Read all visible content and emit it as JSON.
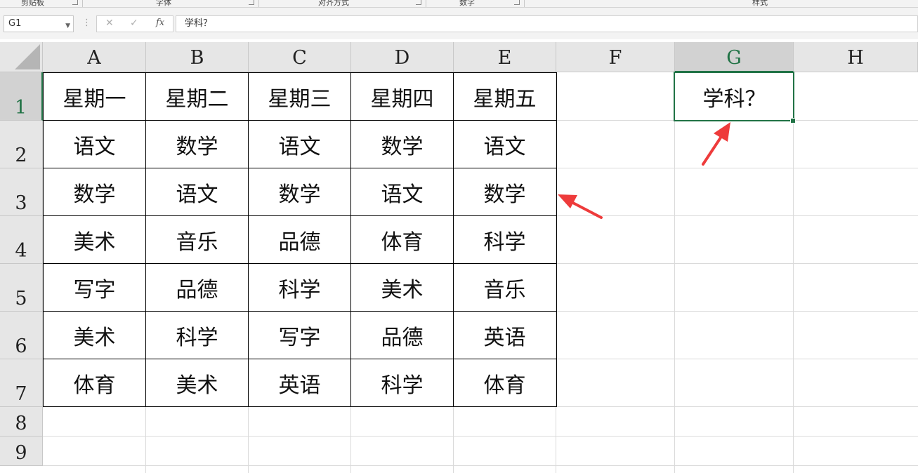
{
  "ribbon": {
    "groups": [
      {
        "label": "剪贴板"
      },
      {
        "label": "字体"
      },
      {
        "label": "对齐方式"
      },
      {
        "label": "数字"
      },
      {
        "label": "样式"
      }
    ]
  },
  "formula_bar": {
    "name_box": "G1",
    "cancel_symbol": "✕",
    "enter_symbol": "✓",
    "fx_label": "fx",
    "content": "学科？"
  },
  "columns": [
    "A",
    "B",
    "C",
    "D",
    "E",
    "F",
    "G",
    "H"
  ],
  "rows": [
    "1",
    "2",
    "3",
    "4",
    "5",
    "6",
    "7",
    "8",
    "9"
  ],
  "table": [
    [
      "星期一",
      "星期二",
      "星期三",
      "星期四",
      "星期五"
    ],
    [
      "语文",
      "数学",
      "语文",
      "数学",
      "语文"
    ],
    [
      "数学",
      "语文",
      "数学",
      "语文",
      "数学"
    ],
    [
      "美术",
      "音乐",
      "品德",
      "体育",
      "科学"
    ],
    [
      "写字",
      "品德",
      "科学",
      "美术",
      "音乐"
    ],
    [
      "美术",
      "科学",
      "写字",
      "品德",
      "英语"
    ],
    [
      "体育",
      "美术",
      "英语",
      "科学",
      "体育"
    ]
  ],
  "g1_cell": "学科？",
  "active_cell": "G1",
  "colors": {
    "accent_green": "#217346",
    "arrow_red": "#ee3b3b",
    "header_bg": "#e6e6e6"
  }
}
